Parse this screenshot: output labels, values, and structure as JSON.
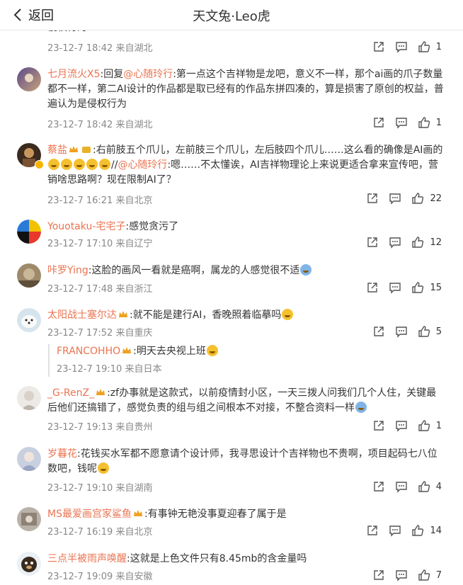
{
  "header": {
    "back_label": "返回",
    "title": "天文兔·Leo虎"
  },
  "top_partial": {
    "text": "侵权行为",
    "time": "23-12-7 18:42",
    "loc": "来自湖北",
    "likes": "1"
  },
  "comments": [
    {
      "user": "七月流火X5",
      "pre": ":回复",
      "mention": "@心随玲行",
      "text": ":第一点这个吉祥物是龙吧，意义不一样，那个ai画的爪子数量都不一样，第二AI设计的作品都是取已经有的作品东拼四凑的，算是损害了原创的权益，普遍认为是侵权行为",
      "time": "23-12-7 18:42",
      "loc": "来自湖北",
      "likes": "1"
    },
    {
      "user": "蔡盐",
      "text1": ":右前肢五个爪儿，左前肢三个爪儿，左后肢四个爪儿……这么看的确像是AI画的",
      "sep": "//",
      "mention": "@心随玲行",
      "text2": ":嗯……不太懂诶，AI吉祥物理论上来说更适合拿来宣传吧，营销啥思路啊？现在限制AI了？",
      "time": "23-12-7 16:21",
      "loc": "来自北京",
      "likes": "22"
    },
    {
      "user": "Youotaku-宅宅子",
      "text": ":感觉贪污了",
      "time": "23-12-7 17:10",
      "loc": "来自辽宁",
      "likes": "12"
    },
    {
      "user": "咔罗Ying",
      "text": ":这脸的画风一看就是癌啊，属龙的人感觉很不适",
      "time": "23-12-7 17:48",
      "loc": "来自浙江",
      "likes": "15"
    },
    {
      "user": "太阳战士塞尔达",
      "text": ":就不能是建行AI，香晚照着临摹吗",
      "time": "23-12-7 17:52",
      "loc": "来自重庆",
      "likes": "5",
      "reply": {
        "user": "FRANCOHHO",
        "text": ":明天去央视上班",
        "time": "23-12-7 19:10",
        "loc": "来自日本"
      }
    },
    {
      "user": "_G-RenZ_",
      "text": ":zf办事就是这款式，以前疫情封小区，一天三拨人问我们几个人住，关键最后他们还搞错了，感觉负责的组与组之间根本不对接，不整合资料一样",
      "time": "23-12-7 19:13",
      "loc": "来自贵州",
      "likes": "1"
    },
    {
      "user": "岁暮花",
      "text": ":花钱买水军都不愿意请个设计师，我寻思设计个吉祥物也不贵啊，项目起码七八位数吧，钱呢",
      "time": "23-12-7 19:10",
      "loc": "来自湖南",
      "likes": "4"
    },
    {
      "user": "MS最爱画宫家鲨鱼",
      "text": ":有事钟无艳没事夏迎春了属于是",
      "time": "23-12-7 16:19",
      "loc": "来自北京",
      "likes": "14"
    },
    {
      "user": "三点半被雨声唤醒",
      "text": ":这就是上色文件只有8.45mb的含金量吗",
      "time": "23-12-7 19:09",
      "loc": "来自安徽",
      "likes": "7"
    }
  ],
  "icons": {
    "share": "share-icon",
    "comment": "comment-icon",
    "like": "like-icon",
    "back": "chevron-left-icon"
  },
  "colors": {
    "username": "#eb7350",
    "meta": "#888888",
    "text": "#333333"
  }
}
